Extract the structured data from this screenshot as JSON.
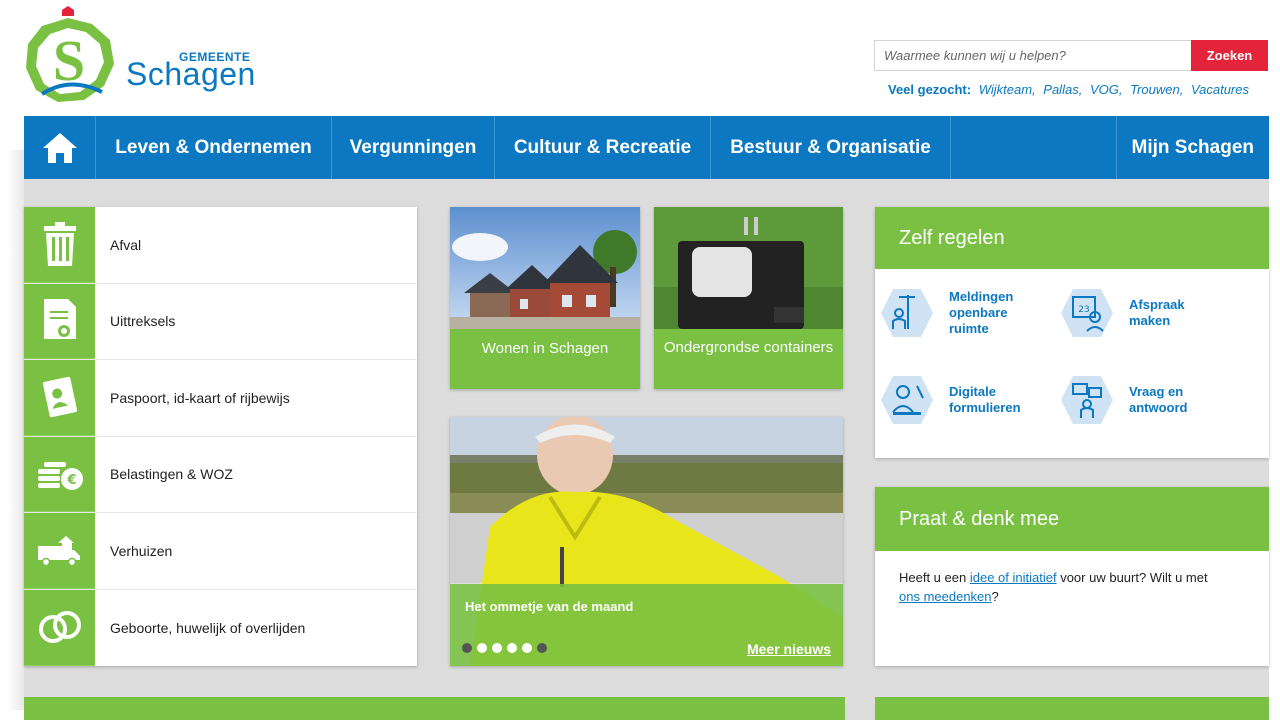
{
  "brand": {
    "small": "GEMEENTE",
    "big": "Schagen",
    "colors": {
      "blue": "#0b78c1",
      "green": "#7ac143",
      "red": "#e3243b"
    }
  },
  "search": {
    "placeholder": "Waarmee kunnen wij u helpen?",
    "button": "Zoeken",
    "popular_label": "Veel gezocht:",
    "popular": [
      "Wijkteam,",
      "Pallas,",
      "VOG,",
      "Trouwen,",
      "Vacatures"
    ]
  },
  "nav": {
    "home_icon": "home-icon",
    "items": [
      "Leven & Ondernemen",
      "Vergunningen",
      "Cultuur & Recreatie",
      "Bestuur & Organisatie"
    ],
    "right": "Mijn Schagen"
  },
  "menu": [
    {
      "label": "Afval",
      "icon": "trash-bin-icon"
    },
    {
      "label": "Uittreksels",
      "icon": "certificate-icon"
    },
    {
      "label": "Paspoort, id-kaart of rijbewijs",
      "icon": "passport-icon"
    },
    {
      "label": "Belastingen & WOZ",
      "icon": "coins-icon"
    },
    {
      "label": "Verhuizen",
      "icon": "moving-truck-icon"
    },
    {
      "label": "Geboorte, huwelijk of overlijden",
      "icon": "rings-icon"
    }
  ],
  "tiles": {
    "wonen": "Wonen in Schagen",
    "containers": "Ondergrondse containers"
  },
  "news": {
    "title": "Het ommetje van de maand",
    "more": "Meer nieuws",
    "slides": 6
  },
  "zelf": {
    "title": "Zelf regelen",
    "items": [
      {
        "label": "Meldingen openbare ruimte",
        "icon": "streetlight-person-icon"
      },
      {
        "label": "Afspraak maken",
        "icon": "calendar-person-icon"
      },
      {
        "label": "Digitale formulieren",
        "icon": "person-laptop-icon"
      },
      {
        "label": "Vraag en antwoord",
        "icon": "question-person-icon"
      }
    ]
  },
  "praat": {
    "title": "Praat & denk mee",
    "text1": "Heeft u een",
    "link1": "idee of initiatief",
    "text2": "voor uw buurt? Wilt u met",
    "link2": "ons meedenken",
    "text3": "?"
  }
}
